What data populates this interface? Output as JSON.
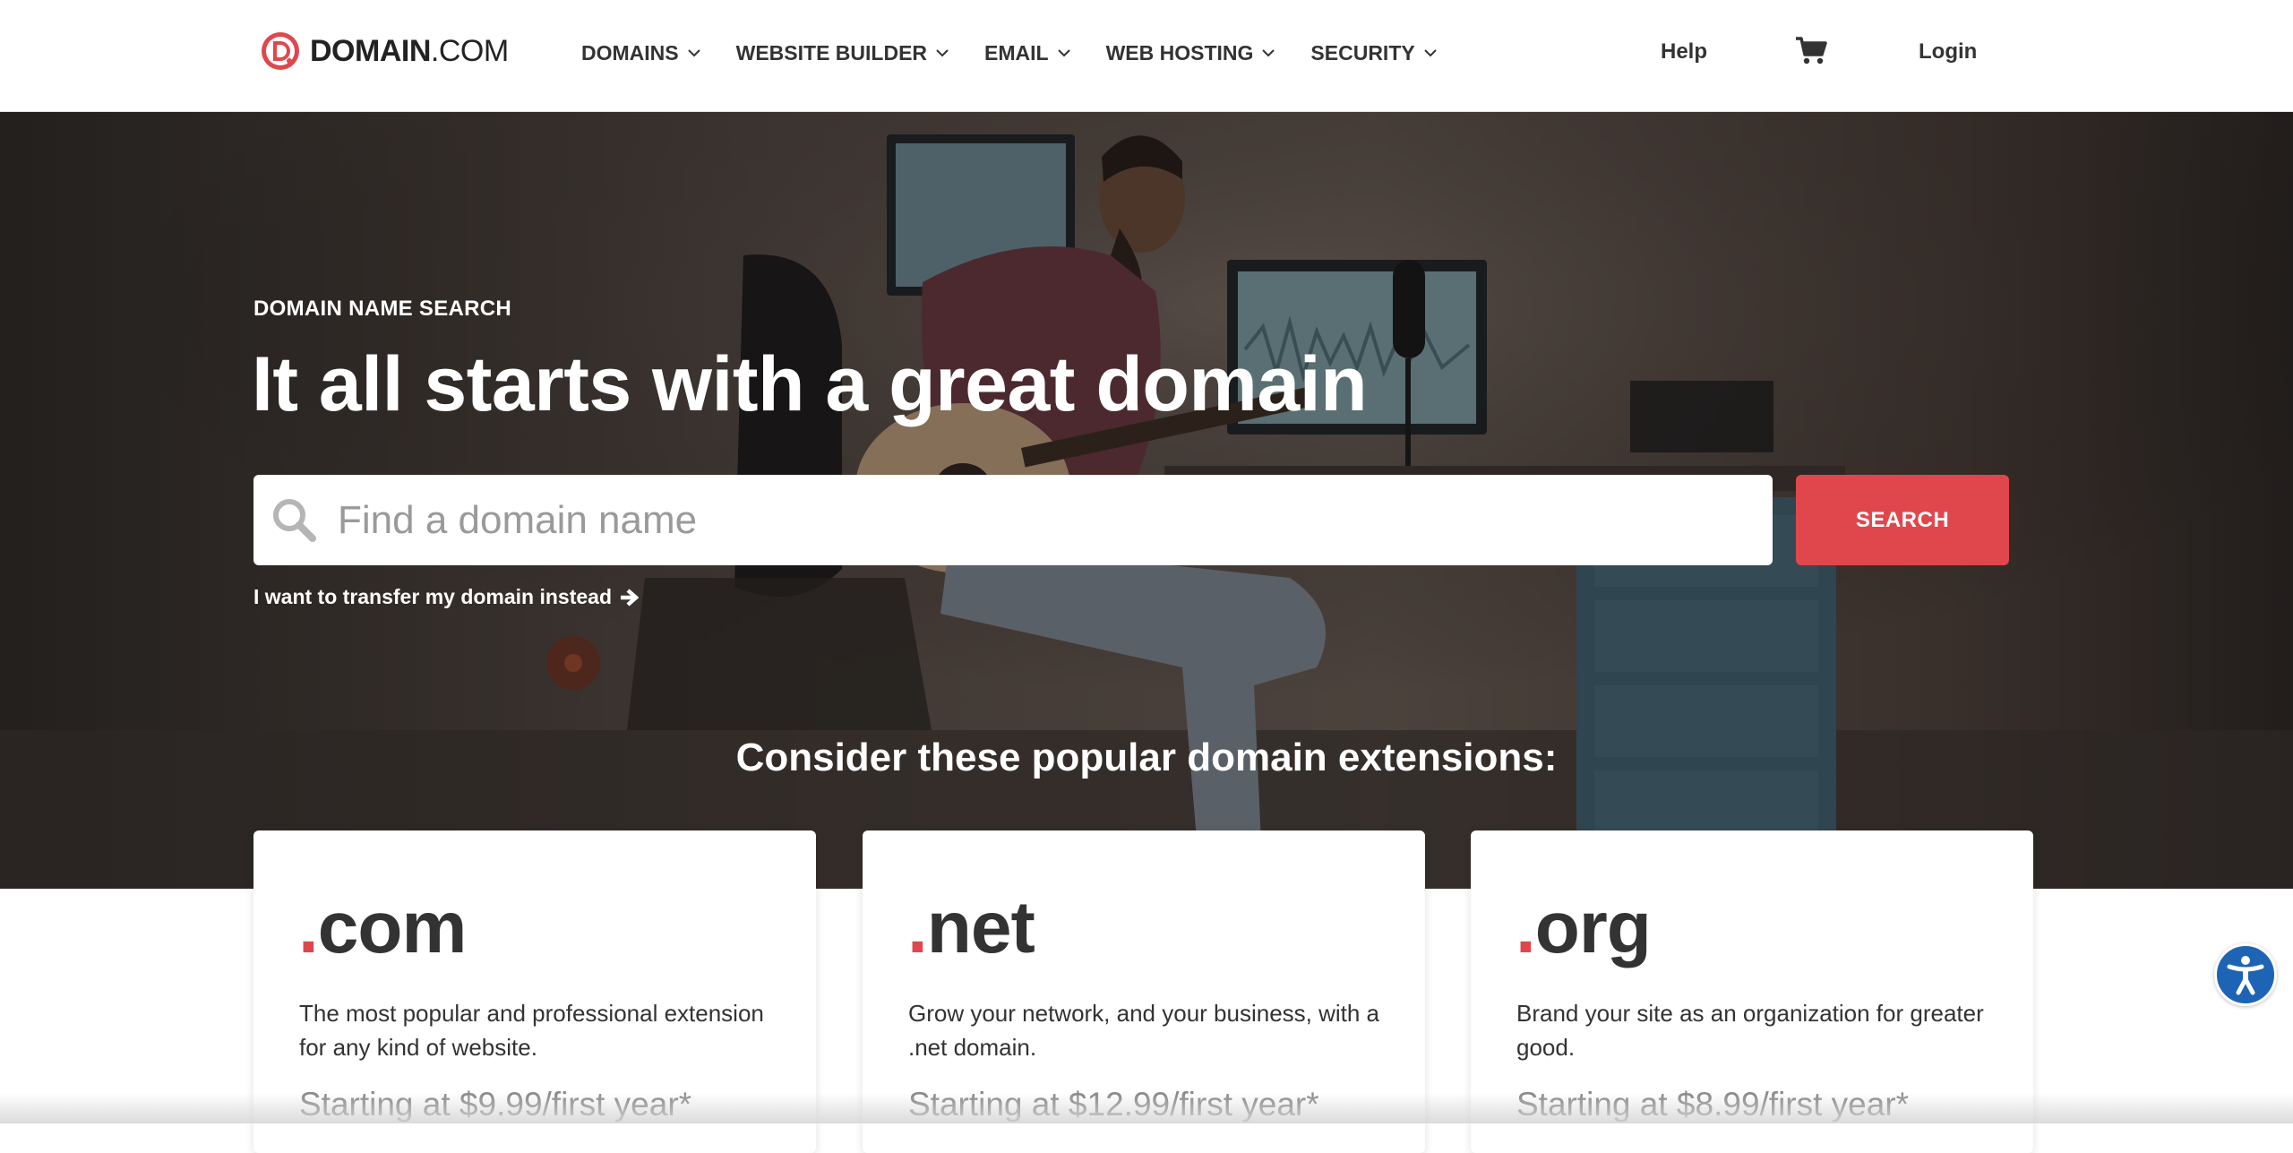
{
  "brand": {
    "name_bold": "DOMAIN",
    "name_light": ".COM",
    "accent": "#e0474c"
  },
  "nav": {
    "items": [
      {
        "label": "DOMAINS"
      },
      {
        "label": "WEBSITE BUILDER"
      },
      {
        "label": "EMAIL"
      },
      {
        "label": "WEB HOSTING"
      },
      {
        "label": "SECURITY"
      }
    ],
    "help_label": "Help",
    "cart_icon": "shopping-cart-icon",
    "login_label": "Login"
  },
  "hero": {
    "eyebrow": "DOMAIN NAME SEARCH",
    "headline": "It all starts with a great domain",
    "search": {
      "placeholder": "Find a domain name",
      "value": "",
      "button_label": "SEARCH"
    },
    "transfer_link": "I want to transfer my domain instead",
    "consider_heading": "Consider these popular domain extensions:"
  },
  "extensions": [
    {
      "dot": ".",
      "name": "com",
      "description": "The most popular and professional extension for any kind of website.",
      "price": "Starting at $9.99/first year*"
    },
    {
      "dot": ".",
      "name": "net",
      "description": "Grow your network, and your business, with a .net domain.",
      "price": "Starting at $12.99/first year*"
    },
    {
      "dot": ".",
      "name": "org",
      "description": "Brand your site as an organization for greater good.",
      "price": "Starting at $8.99/first year*"
    }
  ],
  "accessibility": {
    "icon": "accessibility-icon",
    "color": "#1e64b4"
  }
}
